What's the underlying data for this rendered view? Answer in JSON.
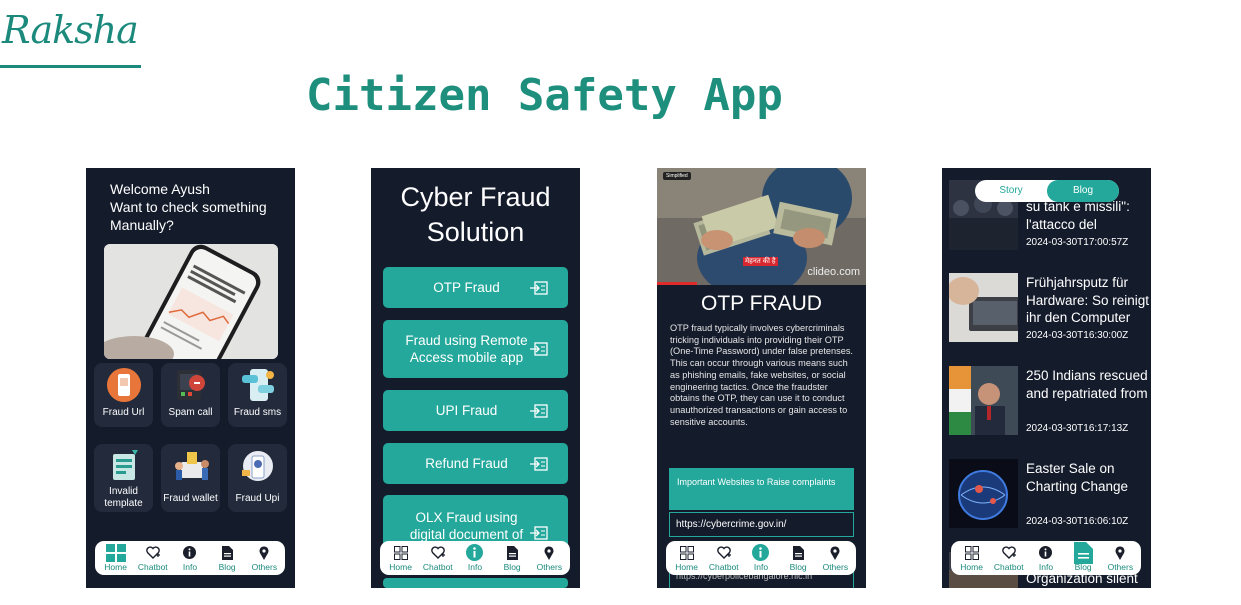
{
  "brand": {
    "logo": "Raksha",
    "title": "Citizen Safety App"
  },
  "nav": {
    "home": "Home",
    "chatbot": "Chatbot",
    "info": "Info",
    "blog": "Blog",
    "others": "Others"
  },
  "screen1": {
    "welcome": "Welcome Ayush",
    "prompt": "Want to check something Manually?",
    "tiles": [
      {
        "label": "Fraud Url"
      },
      {
        "label": "Spam call"
      },
      {
        "label": "Fraud sms"
      },
      {
        "label": "Invalid template"
      },
      {
        "label": "Fraud wallet"
      },
      {
        "label": "Fraud Upi"
      }
    ]
  },
  "screen2": {
    "title": "Cyber Fraud Solution",
    "buttons": [
      {
        "label": "OTP Fraud"
      },
      {
        "label": "Fraud using Remote Access mobile app"
      },
      {
        "label": "UPI Fraud"
      },
      {
        "label": "Refund Fraud"
      },
      {
        "label": "OLX Fraud using digital document of"
      }
    ]
  },
  "screen3": {
    "video_badge": "Simplified",
    "video_caption": "मेहनत की है",
    "watermark": "clideo.com",
    "title": "OTP FRAUD",
    "body": "OTP fraud typically involves cybercriminals tricking individuals into providing their OTP (One-Time Password) under false pretenses. This can occur through various means such as phishing emails, fake websites, or social engineering tactics. Once the fraudster obtains the OTP, they can use it to conduct unauthorized transactions or gain access to sensitive accounts.",
    "box_title": "Important Websites to Raise complaints",
    "links": [
      "https://cybercrime.gov.in/",
      "https://cyberpolicebangalore.nic.in"
    ]
  },
  "screen4": {
    "toggle": {
      "story": "Story",
      "blog": "Blog"
    },
    "posts": [
      {
        "title": "su tank e missili\": l'attacco del",
        "date": "2024-03-30T17:00:57Z"
      },
      {
        "title": "Frühjahrsputz für Hardware: So reinigt ihr den Computer",
        "date": "2024-03-30T16:30:00Z"
      },
      {
        "title": "250 Indians rescued and repatriated from",
        "date": "2024-03-30T16:17:13Z"
      },
      {
        "title": "Easter Sale on Charting Change",
        "date": "2024-03-30T16:06:10Z"
      },
      {
        "title": "Organization silent"
      }
    ]
  },
  "colors": {
    "accent": "#24a89b",
    "brand": "#1b8a7c",
    "phone_bg": "#141b2b"
  }
}
